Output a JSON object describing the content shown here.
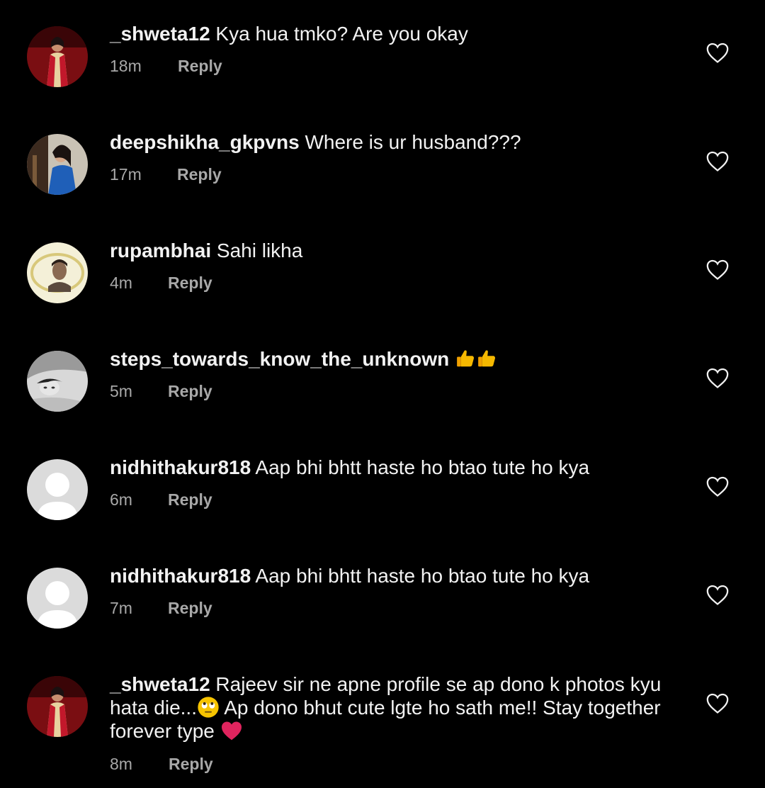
{
  "comments": [
    {
      "username": "_shweta12",
      "text": "Kya hua tmko? Are you okay",
      "time": "18m",
      "reply": "Reply"
    },
    {
      "username": "deepshikha_gkpvns",
      "text": "Where is ur husband???",
      "time": "17m",
      "reply": "Reply"
    },
    {
      "username": "rupambhai",
      "text": "Sahi likha",
      "time": "4m",
      "reply": "Reply"
    },
    {
      "username": "steps_towards_know_the_unknown",
      "text": "",
      "time": "5m",
      "reply": "Reply"
    },
    {
      "username": "nidhithakur818",
      "text": "Aap bhi bhtt haste ho btao tute ho kya",
      "time": "6m",
      "reply": "Reply"
    },
    {
      "username": "nidhithakur818",
      "text": "Aap bhi bhtt haste ho btao tute ho kya",
      "time": "7m",
      "reply": "Reply"
    },
    {
      "username": "_shweta12",
      "text_part1": "Rajeev sir ne apne profile se ap dono k photos kyu hata die...",
      "text_part2": " Ap dono bhut cute lgte ho sath me!! Stay together forever type ",
      "time": "8m",
      "reply": "Reply"
    }
  ],
  "icons": {
    "like": "heart-outline-icon",
    "thumbs_up": "thumbs-up-emoji",
    "eye_roll": "face-with-rolling-eyes-emoji",
    "red_heart": "red-heart-emoji"
  },
  "colors": {
    "background": "#000000",
    "text": "#f2f2f2",
    "meta": "#a8a8a8",
    "heart_emoji": "#e0245e",
    "thumb_emoji": "#f5b800"
  }
}
